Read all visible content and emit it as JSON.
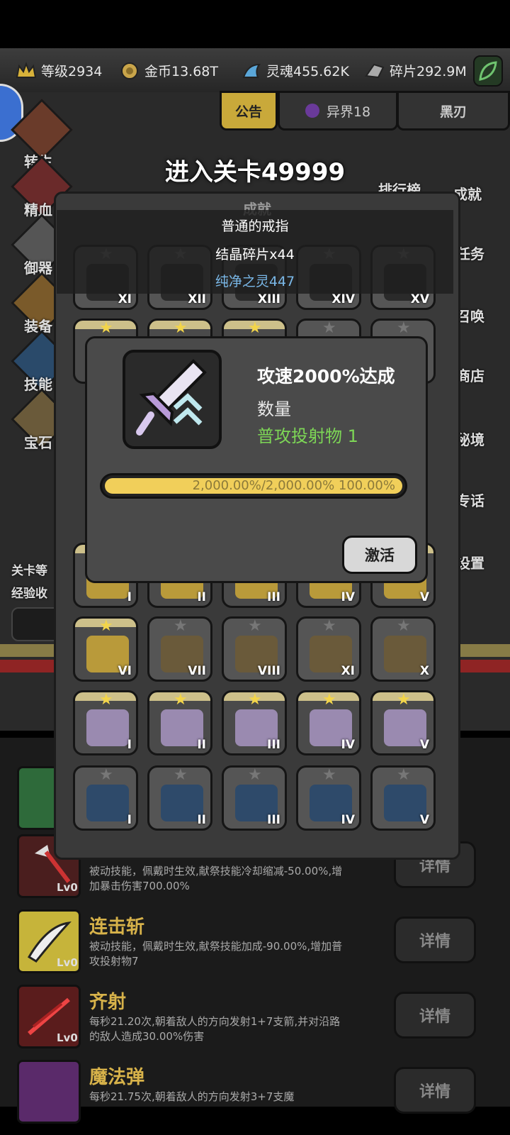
{
  "resources": [
    {
      "icon": "crown-icon",
      "label": "等级2934"
    },
    {
      "icon": "coin-icon",
      "label": "金币13.68T"
    },
    {
      "icon": "soul-icon",
      "label": "灵魂455.62K"
    },
    {
      "icon": "shard-icon",
      "label": "碎片292.9M"
    }
  ],
  "tabs": {
    "notice": "公告",
    "otherworld": "异界18",
    "blade": "黑刃"
  },
  "side_left": [
    "转生",
    "精血",
    "御器",
    "装备",
    "技能",
    "宝石"
  ],
  "side_right": [
    "排行榜",
    "成就",
    "任务",
    "召唤",
    "商店",
    "秘境",
    "专话",
    "设置"
  ],
  "bottom_left": {
    "line1": "关卡等",
    "line2": "经验收"
  },
  "stage_title": "进入关卡49999",
  "panel_header": "成就",
  "reward": {
    "title": "普通的戒指",
    "line1": "结晶碎片x44",
    "line2": "纯净之灵447"
  },
  "grid_numerals": {
    "row1": [
      "XI",
      "XII",
      "XIII",
      "XIV",
      "XV"
    ],
    "row2": [
      "I",
      "II",
      "III",
      "IV",
      "V"
    ],
    "row3": [
      "VI",
      "VII",
      "VIII",
      "XI",
      "X"
    ],
    "row4": [
      "I",
      "II",
      "III",
      "IV",
      "V"
    ],
    "row5": [
      "I",
      "II",
      "III",
      "IV",
      "V"
    ]
  },
  "dialog": {
    "title": "攻速2000%达成",
    "subtitle": "数量",
    "reward": "普攻投射物 1",
    "progress_text": "2,000.00%/2,000.00%  100.00%",
    "progress": 1.0,
    "button": "激活"
  },
  "skills": [
    {
      "name": "",
      "level": "Lv0",
      "desc": "被动技能，佩戴时生效,献祭技能冷却缩减-50.00%,增加暴击伤害700.00%",
      "detail": "详情"
    },
    {
      "name": "连击斩",
      "level": "Lv0",
      "desc": "被动技能，佩戴时生效,献祭技能加成-90.00%,增加普攻投射物7",
      "detail": "详情"
    },
    {
      "name": "齐射",
      "level": "Lv0",
      "desc": "每秒21.20次,朝着敌人的方向发射1+7支箭,并对沿路的敌人造成30.00%伤害",
      "detail": "详情"
    },
    {
      "name": "魔法弹",
      "level": "",
      "desc": "每秒21.75次,朝着敌人的方向发射3+7支魔",
      "detail": "详情"
    }
  ],
  "colors": {
    "gold": "#f1cf5a",
    "green": "#7dd656",
    "skill_name": "#d7b24a"
  }
}
